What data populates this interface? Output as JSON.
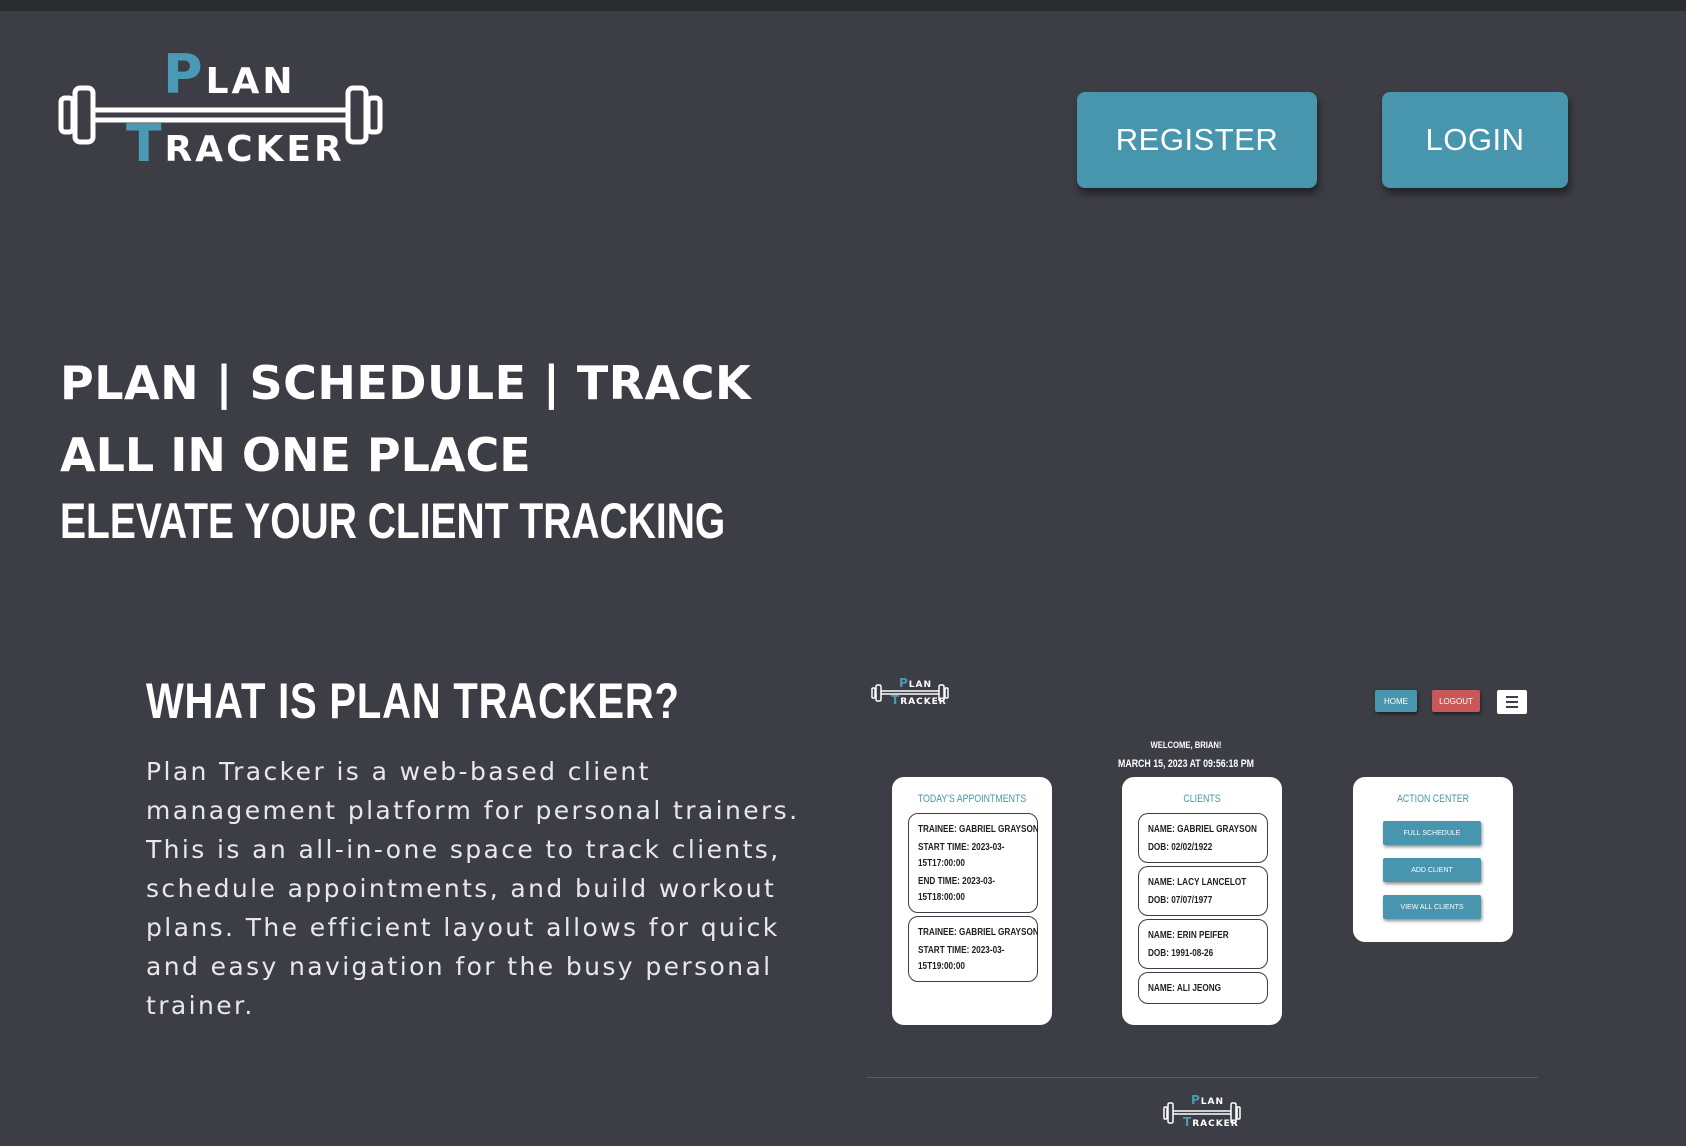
{
  "logo": {
    "plan_cap": "P",
    "plan_rest": "LAN",
    "tracker_cap": "T",
    "tracker_rest": "RACKER"
  },
  "header": {
    "register_label": "REGISTER",
    "login_label": "LOGIN"
  },
  "hero": {
    "line1": "PLAN | SCHEDULE | TRACK",
    "line2": "ALL IN ONE PLACE",
    "line3": "ELEVATE YOUR CLIENT TRACKING"
  },
  "about": {
    "title": "WHAT IS PLAN TRACKER?",
    "body": "Plan Tracker is a web-based client management platform for personal trainers. This is an all-in-one space to track clients, schedule appointments, and build workout plans. The efficient layout allows for quick and easy navigation for the busy personal trainer."
  },
  "preview": {
    "logo": {
      "plan_cap": "P",
      "plan_rest": "LAN",
      "tracker_cap": "T",
      "tracker_rest": "RACKER"
    },
    "nav": {
      "home": "HOME",
      "logout": "LOGOUT"
    },
    "welcome": "WELCOME, BRIAN!",
    "datetime": "MARCH 15, 2023 AT 09:56:18 PM",
    "appointments": {
      "title": "TODAY'S APPOINTMENTS",
      "items": [
        {
          "trainee": "TRAINEE: GABRIEL GRAYSON",
          "start": "START TIME: 2023-03-15T17:00:00",
          "end": "END TIME: 2023-03-15T18:00:00"
        },
        {
          "trainee": "TRAINEE: GABRIEL GRAYSON",
          "start": "START TIME: 2023-03-15T19:00:00",
          "end": ""
        }
      ]
    },
    "clients": {
      "title": "CLIENTS",
      "items": [
        {
          "name": "NAME: GABRIEL GRAYSON",
          "dob": "DOB: 02/02/1922"
        },
        {
          "name": "NAME: LACY LANCELOT",
          "dob": "DOB: 07/07/1977"
        },
        {
          "name": "NAME: ERIN PEIFER",
          "dob": "DOB: 1991-08-26"
        },
        {
          "name": "NAME: ALI JEONG",
          "dob": ""
        }
      ]
    },
    "actions": {
      "title": "ACTION CENTER",
      "full_schedule": "FULL SCHEDULE",
      "add_client": "ADD CLIENT",
      "view_all_clients": "VIEW ALL CLIENTS"
    },
    "footer_logo": {
      "plan_cap": "P",
      "plan_rest": "LAN",
      "tracker_cap": "T",
      "tracker_rest": "RACKER"
    }
  },
  "colors": {
    "background": "#3d3e45",
    "accent": "#4796ad",
    "logout": "#c9585a",
    "text": "#ffffff"
  }
}
